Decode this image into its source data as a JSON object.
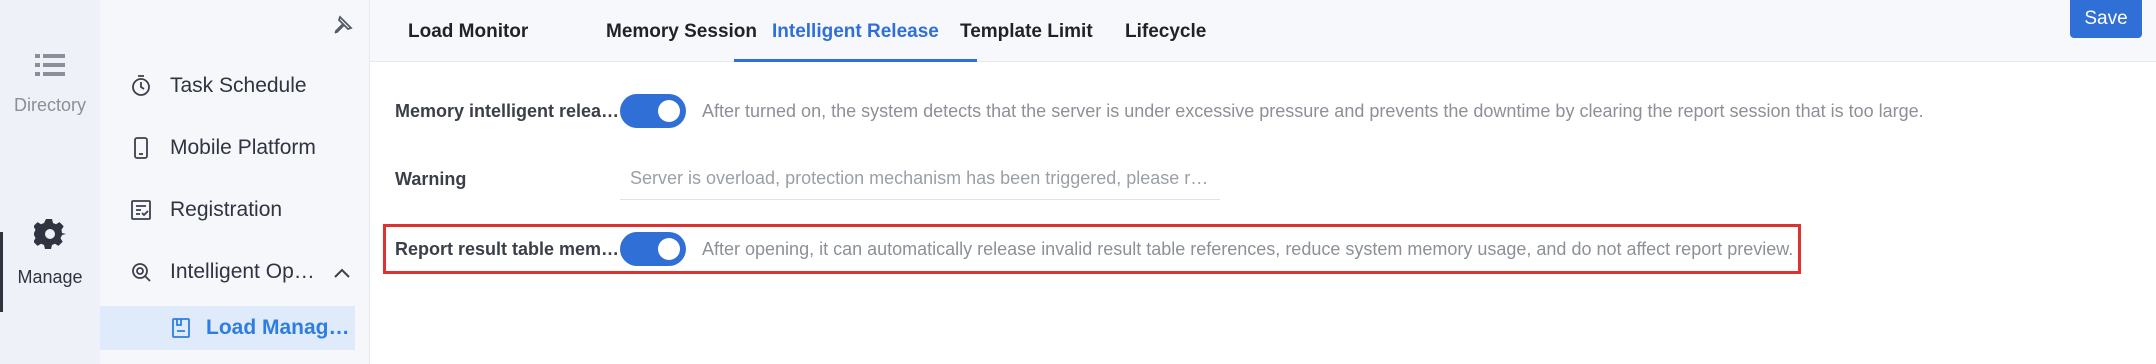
{
  "rail": {
    "directory_label": "Directory",
    "manage_label": "Manage"
  },
  "sidebar": {
    "items": [
      {
        "label": "Task Schedule",
        "icon": "timer-icon"
      },
      {
        "label": "Mobile Platform",
        "icon": "mobile-icon"
      },
      {
        "label": "Registration",
        "icon": "registration-icon"
      },
      {
        "label": "Intelligent Op…",
        "icon": "intelligent-ops-icon",
        "expanded": true
      }
    ],
    "submenu_item": {
      "label": "Load Manag…",
      "icon": "load-manage-icon",
      "selected": true
    }
  },
  "tabs": [
    {
      "label": "Load Monitor"
    },
    {
      "label": "Memory Session"
    },
    {
      "label": "Intelligent Release",
      "active": true
    },
    {
      "label": "Template Limit"
    },
    {
      "label": "Lifecycle"
    }
  ],
  "toolbar": {
    "save_label": "Save"
  },
  "settings": {
    "memory_release": {
      "label": "Memory intelligent relea…",
      "enabled": true,
      "description": "After turned on, the system detects that the server is under excessive pressure and prevents the downtime by clearing the report session that is too large."
    },
    "warning": {
      "label": "Warning",
      "placeholder": "Server is overload, protection mechanism has been triggered, please r…"
    },
    "report_table_memory": {
      "label": "Report result table mem…",
      "enabled": true,
      "description": "After opening, it can automatically release invalid result table references, reduce system memory usage, and do not affect report preview."
    }
  },
  "colors": {
    "accent": "#2f6fd6",
    "highlight": "#e03131"
  }
}
